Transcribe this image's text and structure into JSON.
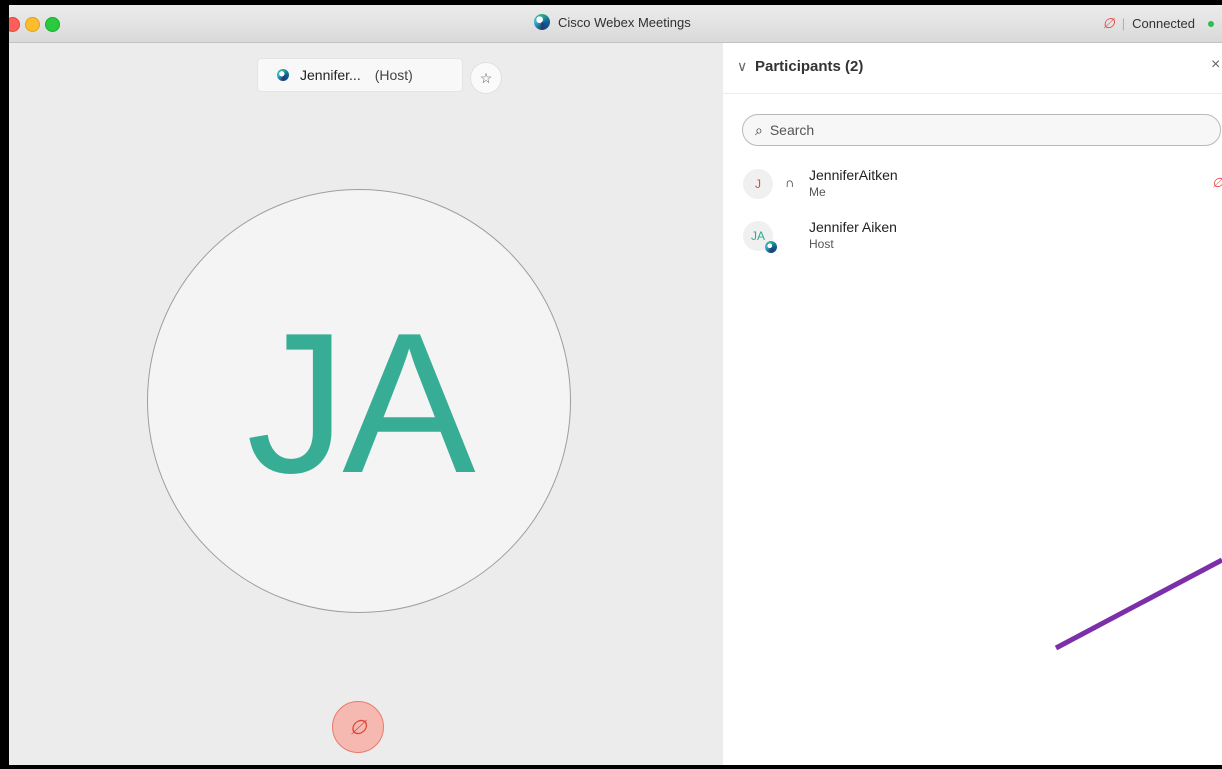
{
  "window": {
    "title": "Cisco Webex Meetings"
  },
  "status": {
    "mic_glyph": "∅",
    "separator": "|",
    "connection": "Connected"
  },
  "stage": {
    "active_name": "Jennifer...",
    "active_role": "(Host)",
    "pin_glyph": "☆",
    "avatar_initials": "JA",
    "mute_glyph": "∅"
  },
  "participants": {
    "chevron": "∨",
    "title": "Participants (2)",
    "close_glyph": "×",
    "search_placeholder": "Search",
    "search_glyph": "⌕",
    "items": [
      {
        "initials": "J",
        "name": "JenniferAitken",
        "subtitle": "Me",
        "headset": "∩",
        "mic": "∅"
      },
      {
        "initials": "JA",
        "name": "Jennifer Aiken",
        "subtitle": "Host"
      }
    ]
  },
  "colors": {
    "accent_teal": "#37ad96",
    "muted_red": "#e2483f",
    "connected_green": "#2dbf4a",
    "annotation_purple": "#7b2fa8"
  },
  "icons": {
    "webex_logo": "webex-logo-icon",
    "mic_muted": "mic-muted-icon",
    "pin": "pin-icon",
    "headset": "headset-icon",
    "search": "search-icon",
    "close": "close-icon"
  }
}
